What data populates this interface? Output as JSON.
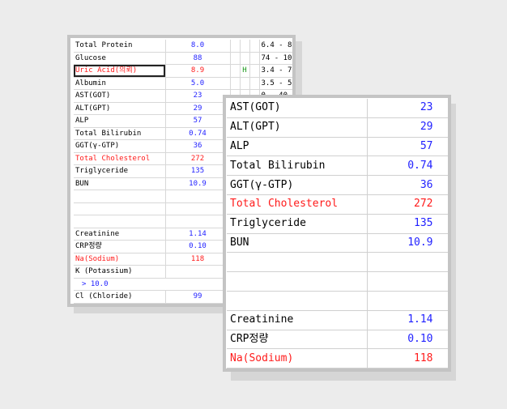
{
  "back_table": {
    "rows": [
      {
        "name": "Total Protein",
        "value": "8.0",
        "flag": "",
        "range": "6.4 - 8",
        "name_red": false,
        "value_red": false
      },
      {
        "name": "Glucose",
        "value": "88",
        "flag": "",
        "range": "74 - 10",
        "name_red": false,
        "value_red": false
      },
      {
        "name": "Uric Acid(의뢰)",
        "value": "8.9",
        "flag": "H",
        "range": "3.4 - 7",
        "name_red": true,
        "value_red": true,
        "selected": true
      },
      {
        "name": "Albumin",
        "value": "5.0",
        "flag": "",
        "range": "3.5 - 5",
        "name_red": false,
        "value_red": false
      },
      {
        "name": "AST(GOT)",
        "value": "23",
        "flag": "",
        "range": "0 - 40",
        "name_red": false,
        "value_red": false
      },
      {
        "name": "ALT(GPT)",
        "value": "29",
        "flag": "",
        "range": "",
        "name_red": false,
        "value_red": false
      },
      {
        "name": "ALP",
        "value": "57",
        "flag": "",
        "range": "",
        "name_red": false,
        "value_red": false
      },
      {
        "name": "Total Bilirubin",
        "value": "0.74",
        "flag": "",
        "range": "",
        "name_red": false,
        "value_red": false
      },
      {
        "name": "GGT(γ-GTP)",
        "value": "36",
        "flag": "",
        "range": "",
        "name_red": false,
        "value_red": false
      },
      {
        "name": "Total Cholesterol",
        "value": "272",
        "flag": "",
        "range": "",
        "name_red": true,
        "value_red": true
      },
      {
        "name": "Triglyceride",
        "value": "135",
        "flag": "",
        "range": "",
        "name_red": false,
        "value_red": false
      },
      {
        "name": "BUN",
        "value": "10.9",
        "flag": "",
        "range": "",
        "name_red": false,
        "value_red": false
      },
      {
        "name": "",
        "value": "",
        "flag": "",
        "range": ""
      },
      {
        "name": "",
        "value": "",
        "flag": "",
        "range": ""
      },
      {
        "name": "",
        "value": "",
        "flag": "",
        "range": ""
      },
      {
        "name": "Creatinine",
        "value": "1.14",
        "flag": "",
        "range": "",
        "name_red": false,
        "value_red": false
      },
      {
        "name": "CRP정량",
        "value": "0.10",
        "flag": "",
        "range": "",
        "name_red": false,
        "value_red": false
      },
      {
        "name": "Na(Sodium)",
        "value": "118",
        "flag": "",
        "range": "",
        "name_red": true,
        "value_red": true
      },
      {
        "name": "K (Potassium)",
        "value": "",
        "flag": "",
        "range": ""
      },
      {
        "name": "> 10.0",
        "value": "",
        "flag": "",
        "range": "",
        "indent": true
      },
      {
        "name": "Cl (Chloride)",
        "value": "99",
        "flag": "",
        "range": ""
      }
    ]
  },
  "front_table": {
    "rows": [
      {
        "name": "AST(GOT)",
        "value": "23"
      },
      {
        "name": "ALT(GPT)",
        "value": "29"
      },
      {
        "name": "ALP",
        "value": "57"
      },
      {
        "name": "Total Bilirubin",
        "value": "0.74"
      },
      {
        "name": "GGT(γ-GTP)",
        "value": "36"
      },
      {
        "name": "Total Cholesterol",
        "value": "272",
        "red": true
      },
      {
        "name": "Triglyceride",
        "value": "135"
      },
      {
        "name": "BUN",
        "value": "10.9"
      },
      {
        "name": "",
        "value": ""
      },
      {
        "name": "",
        "value": ""
      },
      {
        "name": "",
        "value": ""
      },
      {
        "name": "Creatinine",
        "value": "1.14"
      },
      {
        "name": "CRP정량",
        "value": "0.10"
      },
      {
        "name": "Na(Sodium)",
        "value": "118",
        "red": true
      }
    ]
  },
  "colors": {
    "value": "#1f1fff",
    "abnormal": "#ff1a1a",
    "flag": "#1a9a1a"
  }
}
